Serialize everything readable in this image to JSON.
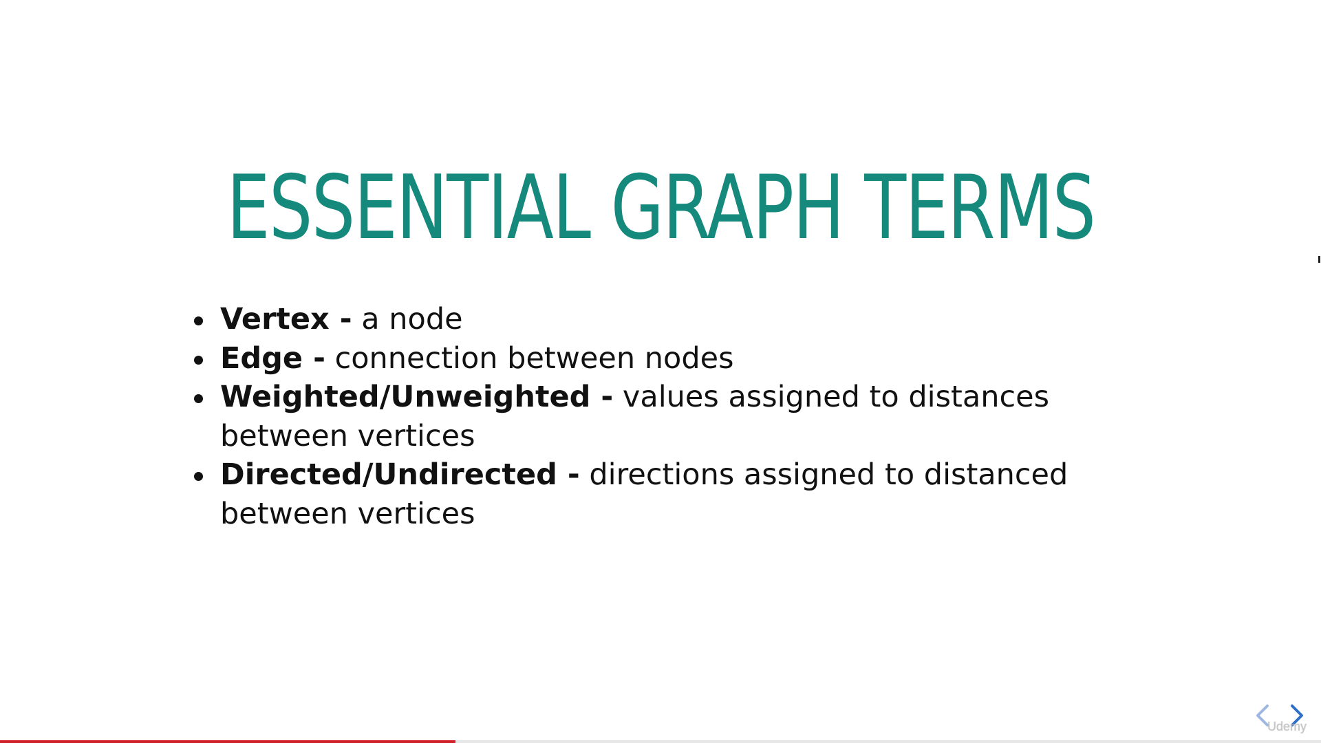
{
  "slide": {
    "title": "ESSENTIAL GRAPH TERMS",
    "title_color": "#14897c",
    "bullets": [
      {
        "term": "Vertex -",
        "description": " a node"
      },
      {
        "term": "Edge -",
        "description": " connection between nodes"
      },
      {
        "term": "Weighted/Unweighted -",
        "description": " values assigned to distances between vertices"
      },
      {
        "term": "Directed/Undirected -",
        "description": " directions assigned to distanced between vertices"
      }
    ]
  },
  "player": {
    "progress_fraction": 0.345,
    "progress_color": "#d0202a",
    "prev_icon": "chevron-left-icon",
    "next_icon": "chevron-right-icon",
    "nav_color": "#2f6fc8",
    "watermark": "Udemy"
  }
}
